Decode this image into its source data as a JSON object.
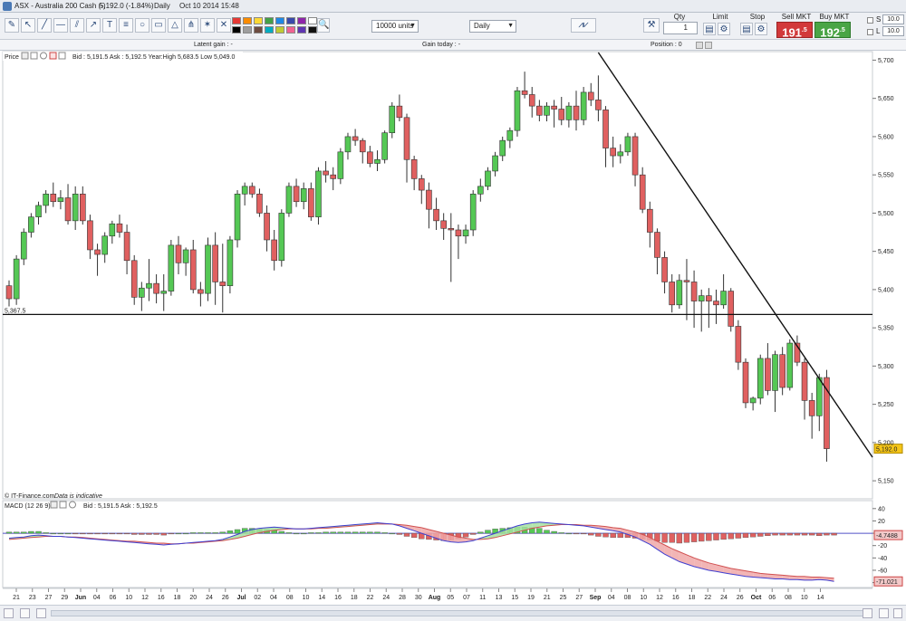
{
  "window": {
    "title": "ASX - Australia 200 Cash (-)",
    "price_change": "5,192.0 (-1.84%)",
    "timeframe": "Daily",
    "datetime": "Oct 10 2014 15:48"
  },
  "toolbar": {
    "units_select": "10000 units",
    "interval_select": "Daily",
    "qty_label": "Qty",
    "qty_value": "1",
    "limit_label": "Limit",
    "stop_label": "Stop",
    "sell_label": "Sell MKT",
    "sell_price": "191",
    "sell_price_sup": ".5",
    "buy_label": "Buy MKT",
    "buy_price": "192",
    "buy_price_sup": ".5",
    "s_label": "S",
    "l_label": "L",
    "s_value": "10.0",
    "l_value": "10.0",
    "colors": [
      "#e53935",
      "#fb8c00",
      "#fdd835",
      "#43a047",
      "#1e88e5",
      "#3949ab",
      "#8e24aa",
      "#ffffff",
      "#000000",
      "#9e9e9e",
      "#6d4c41",
      "#00acc1",
      "#c0ca33",
      "#f06292",
      "#5e35b1",
      "#111111"
    ]
  },
  "info_bar": {
    "latent_gain": "Latent gain : -",
    "gain_today": "Gain today : -",
    "position": "Position : 0"
  },
  "price_panel": {
    "label": "Price",
    "quote": "Bid : 5,191.5 Ask : 5,192.5 Year:High 5,683.5 Low 5,049.0",
    "source": "© IT-Finance.com",
    "indicative": "Data is indicative",
    "support_label": "5,367.5",
    "last_price_badge": "5,192.0"
  },
  "macd_panel": {
    "label": "MACD (12 26 9)",
    "quote": "Bid : 5,191.5 Ask : 5,192.5",
    "badge_macd": "-4.7488",
    "badge_signal": "-71.021"
  },
  "chart_data": [
    {
      "type": "candlestick",
      "title": "ASX - Australia 200 Cash (-)",
      "ylim": [
        5130,
        5710
      ],
      "y_ticks": [
        "5,150",
        "5,200",
        "5,250",
        "5,300",
        "5,350",
        "5,400",
        "5,450",
        "5,500",
        "5,550",
        "5,600",
        "5,650",
        "5,700"
      ],
      "y_tick_values": [
        5150,
        5200,
        5250,
        5300,
        5350,
        5400,
        5450,
        5500,
        5550,
        5600,
        5650,
        5700
      ],
      "x_tick_labels": [
        "21",
        "23",
        "27",
        "29",
        "Jun",
        "04",
        "06",
        "10",
        "12",
        "16",
        "18",
        "20",
        "24",
        "26",
        "Jul",
        "02",
        "04",
        "08",
        "10",
        "14",
        "16",
        "18",
        "22",
        "24",
        "28",
        "30",
        "Aug",
        "05",
        "07",
        "11",
        "13",
        "15",
        "19",
        "21",
        "25",
        "27",
        "Sep",
        "04",
        "08",
        "10",
        "12",
        "16",
        "18",
        "22",
        "24",
        "26",
        "Oct",
        "06",
        "08",
        "10",
        "14"
      ],
      "x_tick_bold": [
        "Jun",
        "Jul",
        "Aug",
        "Sep",
        "Oct"
      ],
      "up_color": "#55c855",
      "down_color": "#e06060",
      "candles": [
        [
          5405,
          5412,
          5378,
          5388
        ],
        [
          5388,
          5445,
          5380,
          5440
        ],
        [
          5440,
          5480,
          5432,
          5475
        ],
        [
          5475,
          5500,
          5468,
          5495
        ],
        [
          5495,
          5515,
          5485,
          5510
        ],
        [
          5510,
          5530,
          5500,
          5525
        ],
        [
          5525,
          5540,
          5508,
          5515
        ],
        [
          5515,
          5530,
          5505,
          5520
        ],
        [
          5520,
          5538,
          5485,
          5490
        ],
        [
          5490,
          5535,
          5478,
          5525
        ],
        [
          5525,
          5535,
          5485,
          5490
        ],
        [
          5490,
          5498,
          5440,
          5452
        ],
        [
          5452,
          5460,
          5418,
          5446
        ],
        [
          5446,
          5475,
          5435,
          5470
        ],
        [
          5470,
          5490,
          5460,
          5486
        ],
        [
          5486,
          5498,
          5468,
          5475
        ],
        [
          5475,
          5485,
          5420,
          5438
        ],
        [
          5438,
          5445,
          5380,
          5390
        ],
        [
          5390,
          5410,
          5372,
          5402
        ],
        [
          5402,
          5440,
          5385,
          5408
        ],
        [
          5408,
          5420,
          5382,
          5395
        ],
        [
          5395,
          5420,
          5372,
          5398
        ],
        [
          5398,
          5465,
          5392,
          5458
        ],
        [
          5458,
          5470,
          5420,
          5435
        ],
        [
          5435,
          5455,
          5418,
          5452
        ],
        [
          5452,
          5465,
          5395,
          5400
        ],
        [
          5400,
          5410,
          5378,
          5395
        ],
        [
          5395,
          5468,
          5385,
          5458
        ],
        [
          5458,
          5475,
          5380,
          5410
        ],
        [
          5410,
          5460,
          5370,
          5405
        ],
        [
          5405,
          5470,
          5395,
          5465
        ],
        [
          5465,
          5530,
          5455,
          5525
        ],
        [
          5525,
          5540,
          5510,
          5535
        ],
        [
          5535,
          5540,
          5520,
          5525
        ],
        [
          5525,
          5532,
          5495,
          5500
        ],
        [
          5500,
          5510,
          5450,
          5465
        ],
        [
          5465,
          5478,
          5425,
          5438
        ],
        [
          5438,
          5505,
          5430,
          5500
        ],
        [
          5500,
          5540,
          5495,
          5535
        ],
        [
          5535,
          5545,
          5508,
          5515
        ],
        [
          5515,
          5540,
          5505,
          5532
        ],
        [
          5532,
          5540,
          5490,
          5495
        ],
        [
          5495,
          5560,
          5485,
          5555
        ],
        [
          5555,
          5568,
          5540,
          5550
        ],
        [
          5550,
          5560,
          5530,
          5545
        ],
        [
          5545,
          5585,
          5538,
          5580
        ],
        [
          5580,
          5605,
          5570,
          5600
        ],
        [
          5600,
          5610,
          5588,
          5595
        ],
        [
          5595,
          5598,
          5565,
          5580
        ],
        [
          5580,
          5588,
          5560,
          5565
        ],
        [
          5565,
          5582,
          5555,
          5570
        ],
        [
          5570,
          5608,
          5565,
          5605
        ],
        [
          5605,
          5645,
          5598,
          5640
        ],
        [
          5640,
          5655,
          5620,
          5625
        ],
        [
          5625,
          5630,
          5540,
          5570
        ],
        [
          5570,
          5575,
          5530,
          5545
        ],
        [
          5545,
          5550,
          5512,
          5530
        ],
        [
          5530,
          5540,
          5480,
          5505
        ],
        [
          5505,
          5520,
          5478,
          5490
        ],
        [
          5490,
          5500,
          5465,
          5480
        ],
        [
          5480,
          5500,
          5410,
          5478
        ],
        [
          5478,
          5485,
          5440,
          5470
        ],
        [
          5470,
          5485,
          5460,
          5478
        ],
        [
          5478,
          5530,
          5470,
          5525
        ],
        [
          5525,
          5545,
          5515,
          5535
        ],
        [
          5535,
          5560,
          5530,
          5555
        ],
        [
          5555,
          5580,
          5548,
          5575
        ],
        [
          5575,
          5600,
          5568,
          5595
        ],
        [
          5595,
          5612,
          5585,
          5608
        ],
        [
          5608,
          5665,
          5600,
          5660
        ],
        [
          5660,
          5685,
          5650,
          5655
        ],
        [
          5655,
          5665,
          5625,
          5640
        ],
        [
          5640,
          5648,
          5620,
          5628
        ],
        [
          5628,
          5645,
          5620,
          5640
        ],
        [
          5640,
          5648,
          5612,
          5636
        ],
        [
          5636,
          5652,
          5615,
          5622
        ],
        [
          5622,
          5645,
          5612,
          5640
        ],
        [
          5640,
          5660,
          5608,
          5622
        ],
        [
          5622,
          5665,
          5615,
          5658
        ],
        [
          5658,
          5670,
          5640,
          5648
        ],
        [
          5648,
          5680,
          5620,
          5635
        ],
        [
          5635,
          5640,
          5560,
          5585
        ],
        [
          5585,
          5600,
          5560,
          5575
        ],
        [
          5575,
          5590,
          5565,
          5580
        ],
        [
          5580,
          5605,
          5575,
          5600
        ],
        [
          5600,
          5605,
          5535,
          5550
        ],
        [
          5550,
          5560,
          5500,
          5505
        ],
        [
          5505,
          5515,
          5455,
          5475
        ],
        [
          5475,
          5480,
          5420,
          5442
        ],
        [
          5442,
          5450,
          5395,
          5410
        ],
        [
          5410,
          5420,
          5370,
          5380
        ],
        [
          5380,
          5420,
          5375,
          5412
        ],
        [
          5412,
          5440,
          5360,
          5410
        ],
        [
          5410,
          5425,
          5350,
          5385
        ],
        [
          5385,
          5400,
          5345,
          5392
        ],
        [
          5392,
          5402,
          5350,
          5385
        ],
        [
          5385,
          5400,
          5355,
          5380
        ],
        [
          5380,
          5420,
          5375,
          5398
        ],
        [
          5398,
          5402,
          5345,
          5352
        ],
        [
          5352,
          5360,
          5295,
          5305
        ],
        [
          5305,
          5310,
          5245,
          5252
        ],
        [
          5252,
          5260,
          5242,
          5258
        ],
        [
          5258,
          5315,
          5250,
          5310
        ],
        [
          5310,
          5330,
          5262,
          5268
        ],
        [
          5268,
          5320,
          5240,
          5315
        ],
        [
          5315,
          5325,
          5262,
          5272
        ],
        [
          5272,
          5335,
          5268,
          5330
        ],
        [
          5330,
          5340,
          5300,
          5305
        ],
        [
          5305,
          5310,
          5230,
          5255
        ],
        [
          5255,
          5265,
          5205,
          5235
        ],
        [
          5235,
          5290,
          5215,
          5285
        ],
        [
          5285,
          5295,
          5175,
          5192
        ]
      ],
      "trendline": {
        "from_index": 80,
        "from_value": 5710,
        "to_index": 112,
        "to_value": 5255
      },
      "support_level": 5367.5
    },
    {
      "type": "macd",
      "title": "MACD (12 26 9)",
      "ylim": [
        -85,
        50
      ],
      "y_ticks": [
        "40",
        "20",
        "0",
        "-20",
        "-40",
        "-60",
        "-80"
      ],
      "y_tick_values": [
        40,
        20,
        0,
        -20,
        -40,
        -60,
        -80
      ],
      "series": [
        {
          "name": "MACD",
          "color": "#3f3fd0",
          "values": [
            -8,
            -7,
            -6,
            -4,
            -3,
            -4,
            -5,
            -5,
            -6,
            -7,
            -8,
            -9,
            -10,
            -11,
            -12,
            -13,
            -14,
            -15,
            -16,
            -17,
            -18,
            -19,
            -18,
            -17,
            -16,
            -15,
            -14,
            -13,
            -12,
            -10,
            -6,
            -2,
            3,
            6,
            8,
            9,
            10,
            9,
            8,
            7,
            7,
            8,
            9,
            10,
            11,
            12,
            13,
            14,
            15,
            16,
            17,
            16,
            15,
            12,
            8,
            4,
            0,
            -4,
            -8,
            -12,
            -14,
            -15,
            -14,
            -12,
            -8,
            -4,
            0,
            4,
            8,
            12,
            15,
            17,
            18,
            17,
            16,
            15,
            14,
            13,
            12,
            10,
            8,
            6,
            4,
            2,
            -2,
            -6,
            -12,
            -18,
            -26,
            -34,
            -40,
            -46,
            -50,
            -54,
            -57,
            -60,
            -62,
            -64,
            -66,
            -68,
            -70,
            -71,
            -72,
            -73,
            -74,
            -74,
            -75,
            -75,
            -76,
            -76,
            -75,
            -76,
            -78
          ]
        },
        {
          "name": "Signal",
          "color": "#d05050",
          "values": [
            -10,
            -9,
            -8,
            -7,
            -6,
            -5,
            -5,
            -5,
            -6,
            -6,
            -7,
            -8,
            -9,
            -10,
            -11,
            -12,
            -13,
            -13,
            -14,
            -15,
            -16,
            -16,
            -17,
            -17,
            -16,
            -16,
            -15,
            -14,
            -13,
            -12,
            -10,
            -8,
            -5,
            -2,
            1,
            3,
            5,
            6,
            7,
            7,
            7,
            7,
            8,
            8,
            9,
            10,
            11,
            12,
            13,
            14,
            15,
            15,
            15,
            14,
            13,
            11,
            9,
            6,
            3,
            0,
            -3,
            -6,
            -8,
            -10,
            -10,
            -9,
            -7,
            -4,
            -1,
            2,
            5,
            8,
            10,
            12,
            13,
            14,
            14,
            14,
            13,
            13,
            12,
            11,
            9,
            8,
            5,
            2,
            -2,
            -7,
            -13,
            -19,
            -25,
            -30,
            -35,
            -40,
            -44,
            -48,
            -51,
            -54,
            -57,
            -59,
            -61,
            -63,
            -65,
            -66,
            -67,
            -68,
            -69,
            -70,
            -70,
            -71,
            -71,
            -72,
            -73
          ]
        },
        {
          "name": "Histogram",
          "color": "#e06060",
          "values": [
            2,
            2,
            2,
            3,
            3,
            1,
            0,
            0,
            0,
            -1,
            -1,
            -1,
            -1,
            -1,
            -1,
            -1,
            -1,
            -2,
            -2,
            -2,
            -2,
            -3,
            -1,
            0,
            0,
            1,
            1,
            1,
            1,
            2,
            4,
            6,
            8,
            8,
            7,
            6,
            5,
            3,
            1,
            0,
            0,
            1,
            1,
            2,
            2,
            2,
            2,
            2,
            2,
            2,
            2,
            1,
            0,
            -2,
            -5,
            -7,
            -9,
            -10,
            -11,
            -12,
            -11,
            -9,
            -6,
            -2,
            2,
            5,
            7,
            8,
            9,
            10,
            10,
            9,
            8,
            5,
            3,
            1,
            0,
            -1,
            -1,
            -3,
            -5,
            -6,
            -7,
            -7,
            -7,
            -8,
            -10,
            -11,
            -13,
            -15,
            -15,
            -16,
            -15,
            -14,
            -13,
            -12,
            -11,
            -10,
            -9,
            -8,
            -7,
            -6,
            -5,
            -4,
            -3,
            -3,
            -3,
            -3,
            -3,
            -3,
            -4,
            -3,
            -3
          ]
        }
      ]
    }
  ]
}
